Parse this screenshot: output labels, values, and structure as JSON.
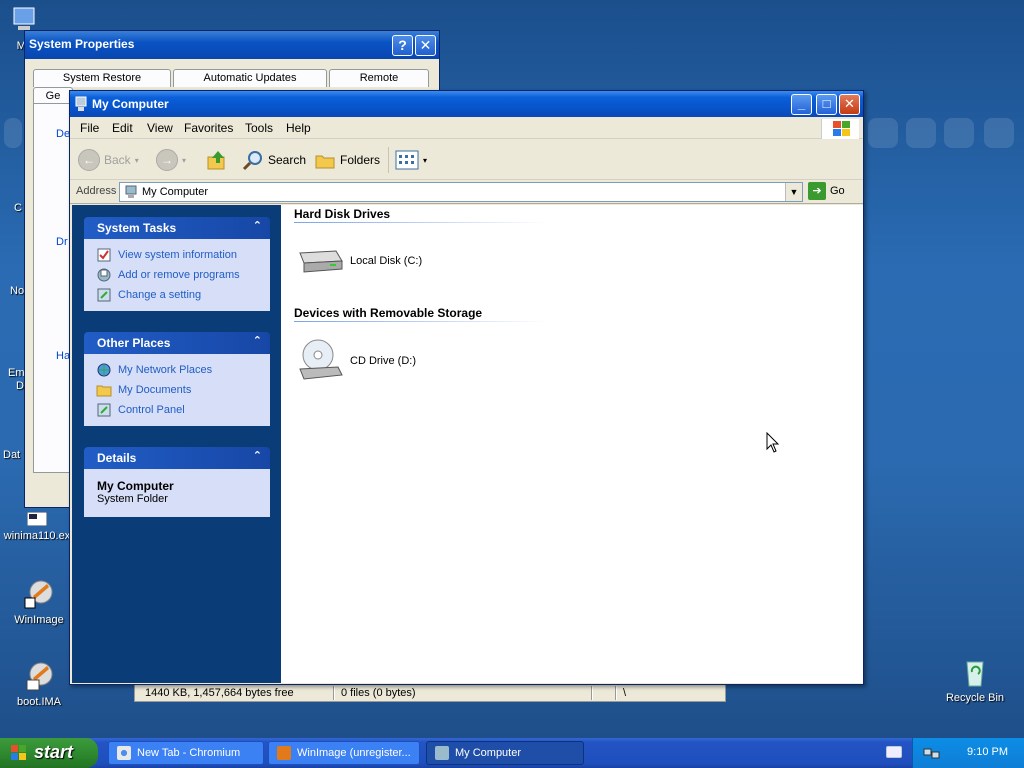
{
  "desktop": {
    "icons": {
      "my_computer": "My",
      "winima_exe": "winima110.ex",
      "winimage": "WinImage",
      "boot_ima": "boot.IMA",
      "recycle_bin": "Recycle Bin"
    },
    "edge_labels": {
      "c": "C",
      "no": "No",
      "em": "Em",
      "d": "D",
      "dat": "Dat"
    }
  },
  "system_properties": {
    "title": "System Properties",
    "tabs": [
      "System Restore",
      "Automatic Updates",
      "Remote"
    ],
    "lower_tab": "Ge",
    "fragments": [
      "De",
      "Dr",
      "Ha"
    ]
  },
  "winimage_status": {
    "free": "1440 KB, 1,457,664 bytes free",
    "files": "0 files (0 bytes)",
    "path": "\\"
  },
  "window": {
    "title": "My Computer",
    "menu": [
      "File",
      "Edit",
      "View",
      "Favorites",
      "Tools",
      "Help"
    ],
    "toolbar": {
      "back": "Back",
      "search": "Search",
      "folders": "Folders"
    },
    "address": {
      "label": "Address",
      "value": "My Computer",
      "go": "Go"
    }
  },
  "task_pane": {
    "system_tasks": {
      "title": "System Tasks",
      "items": [
        "View system information",
        "Add or remove programs",
        "Change a setting"
      ]
    },
    "other_places": {
      "title": "Other Places",
      "items": [
        "My Network Places",
        "My Documents",
        "Control Panel"
      ]
    },
    "details": {
      "title": "Details",
      "name": "My Computer",
      "type": "System Folder"
    }
  },
  "content": {
    "hard_disks": {
      "title": "Hard Disk Drives",
      "items": [
        "Local Disk (C:)"
      ]
    },
    "removable": {
      "title": "Devices with Removable Storage",
      "items": [
        "CD Drive (D:)"
      ]
    }
  },
  "taskbar": {
    "start": "start",
    "buttons": [
      "New Tab - Chromium",
      "WinImage (unregister...",
      "My Computer"
    ],
    "time": "9:10 PM"
  },
  "colors": {
    "title_blue": "#0a5fd9",
    "task_pane_blue": "#0a3c78",
    "link_blue": "#215dc6",
    "start_green": "#2f8a2f"
  }
}
